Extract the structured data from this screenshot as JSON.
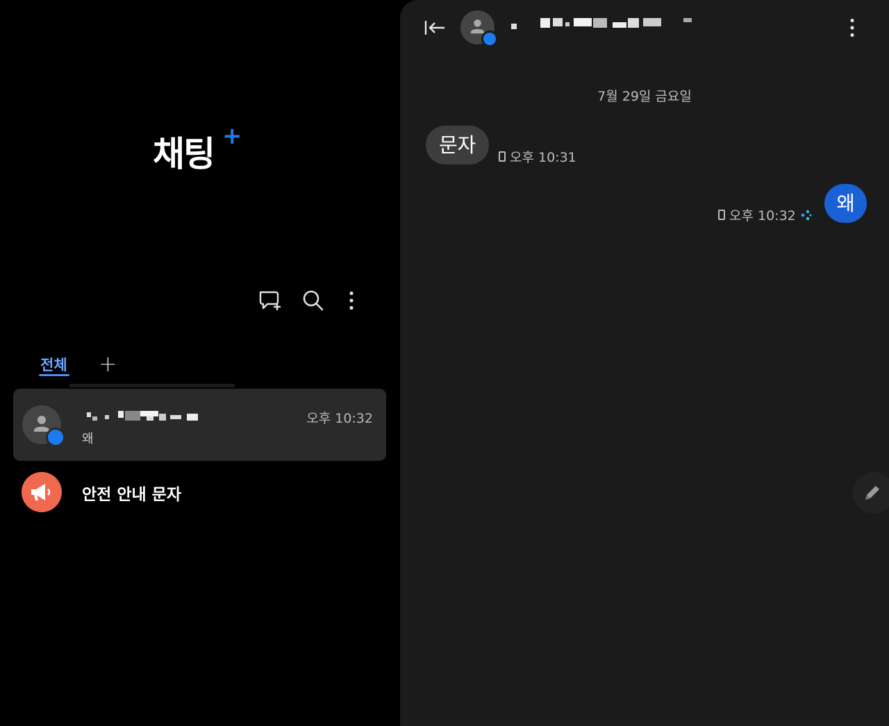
{
  "list_panel": {
    "title": "채팅",
    "title_plus": "+",
    "tabs": [
      {
        "label": "전체"
      }
    ],
    "add_tab_label": "+",
    "conversations": [
      {
        "time": "오후 10:32",
        "preview": "왜"
      }
    ],
    "safety_item": {
      "label": "안전 안내 문자"
    }
  },
  "chat_panel": {
    "date_separator": "7월 29일 금요일",
    "messages": [
      {
        "direction": "incoming",
        "text": "문자",
        "time": "오후 10:31"
      },
      {
        "direction": "outgoing",
        "text": "왜",
        "time": "오후 10:32"
      }
    ]
  },
  "icons": {
    "new_chat": "chat-plus-icon",
    "search": "search-icon",
    "more": "more-vert-icon",
    "back": "collapse-left-icon",
    "edit": "pencil-icon",
    "safety": "megaphone-icon"
  },
  "colors": {
    "accent": "#1f7af0",
    "outgoing_bubble": "#1b61d6",
    "incoming_bubble": "#3d3d3d",
    "safety_icon_bg": "#f0694f"
  }
}
